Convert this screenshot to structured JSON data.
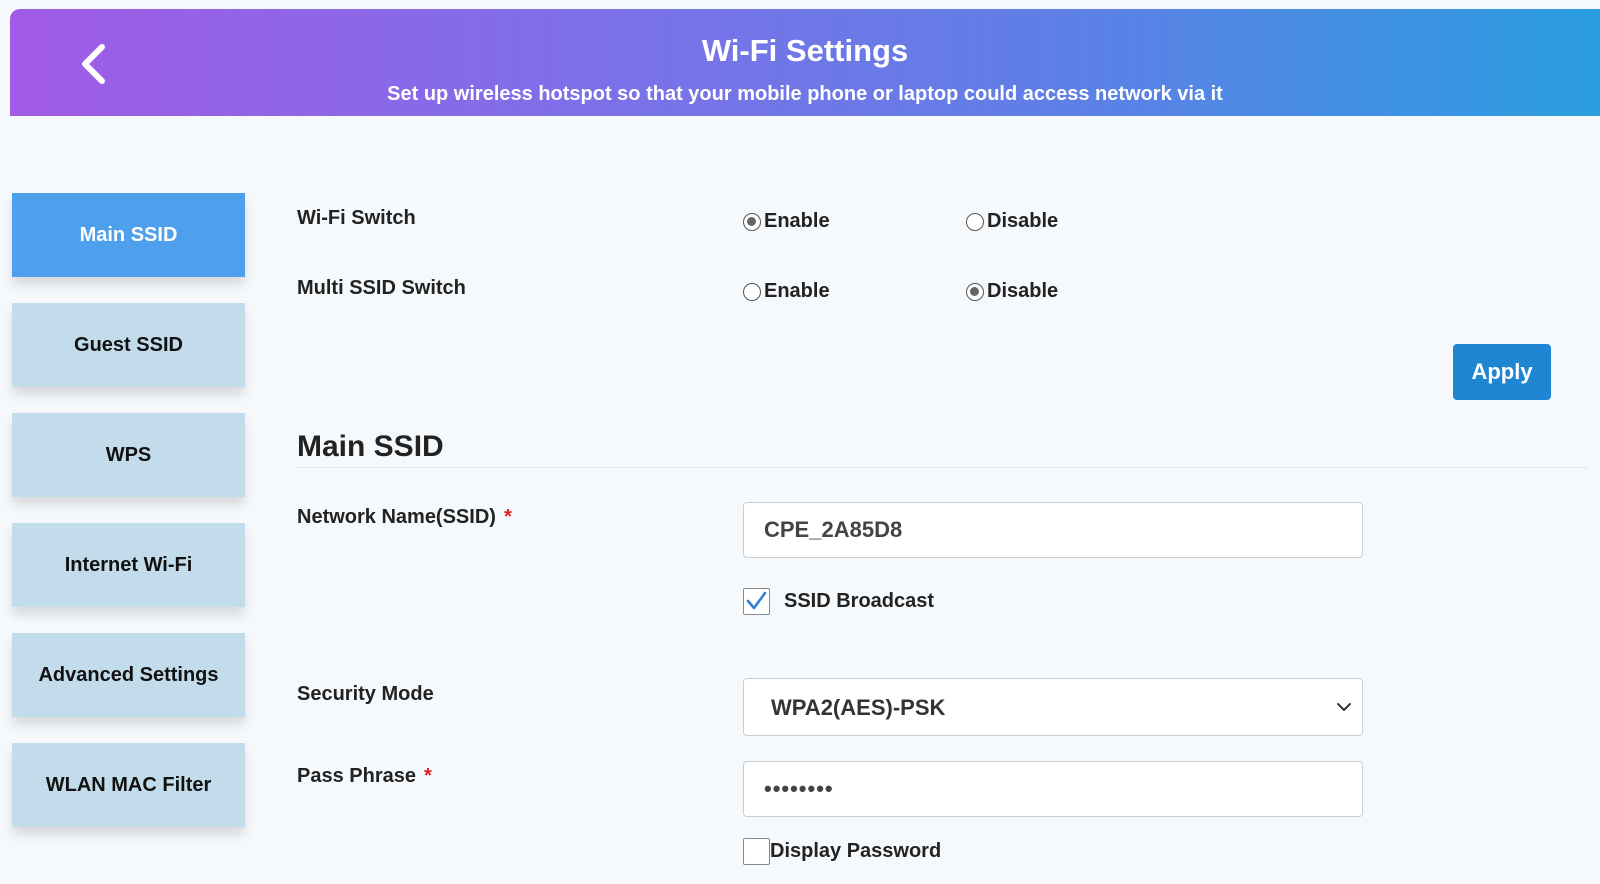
{
  "header": {
    "title": "Wi-Fi Settings",
    "subtitle": "Set up wireless hotspot so that your mobile phone or laptop could access network via it",
    "back_icon": "chevron-left-icon"
  },
  "sidebar": {
    "items": [
      {
        "label": "Main SSID",
        "active": true
      },
      {
        "label": "Guest SSID",
        "active": false
      },
      {
        "label": "WPS",
        "active": false
      },
      {
        "label": "Internet Wi-Fi",
        "active": false
      },
      {
        "label": "Advanced Settings",
        "active": false
      },
      {
        "label": "WLAN MAC Filter",
        "active": false
      }
    ]
  },
  "switches": {
    "wifi": {
      "label": "Wi-Fi Switch",
      "options": [
        {
          "label": "Enable",
          "checked": true
        },
        {
          "label": "Disable",
          "checked": false
        }
      ]
    },
    "multi_ssid": {
      "label": "Multi SSID Switch",
      "options": [
        {
          "label": "Enable",
          "checked": false
        },
        {
          "label": "Disable",
          "checked": true
        }
      ]
    }
  },
  "apply_label": "Apply",
  "main_ssid": {
    "section_title": "Main SSID",
    "network_name": {
      "label": "Network Name(SSID)",
      "required": "*",
      "value": "CPE_2A85D8"
    },
    "ssid_broadcast": {
      "label": "SSID Broadcast",
      "checked": true
    },
    "security_mode": {
      "label": "Security Mode",
      "value": "WPA2(AES)-PSK"
    },
    "pass_phrase": {
      "label": "Pass Phrase",
      "required": "*",
      "value": "••••••••"
    },
    "display_password": {
      "label": "Display Password",
      "checked": false
    }
  },
  "colors": {
    "active_tab": "#4fa0ec",
    "inactive_tab": "#c3dcec",
    "apply_button": "#1f86d3",
    "required": "#e02020"
  }
}
